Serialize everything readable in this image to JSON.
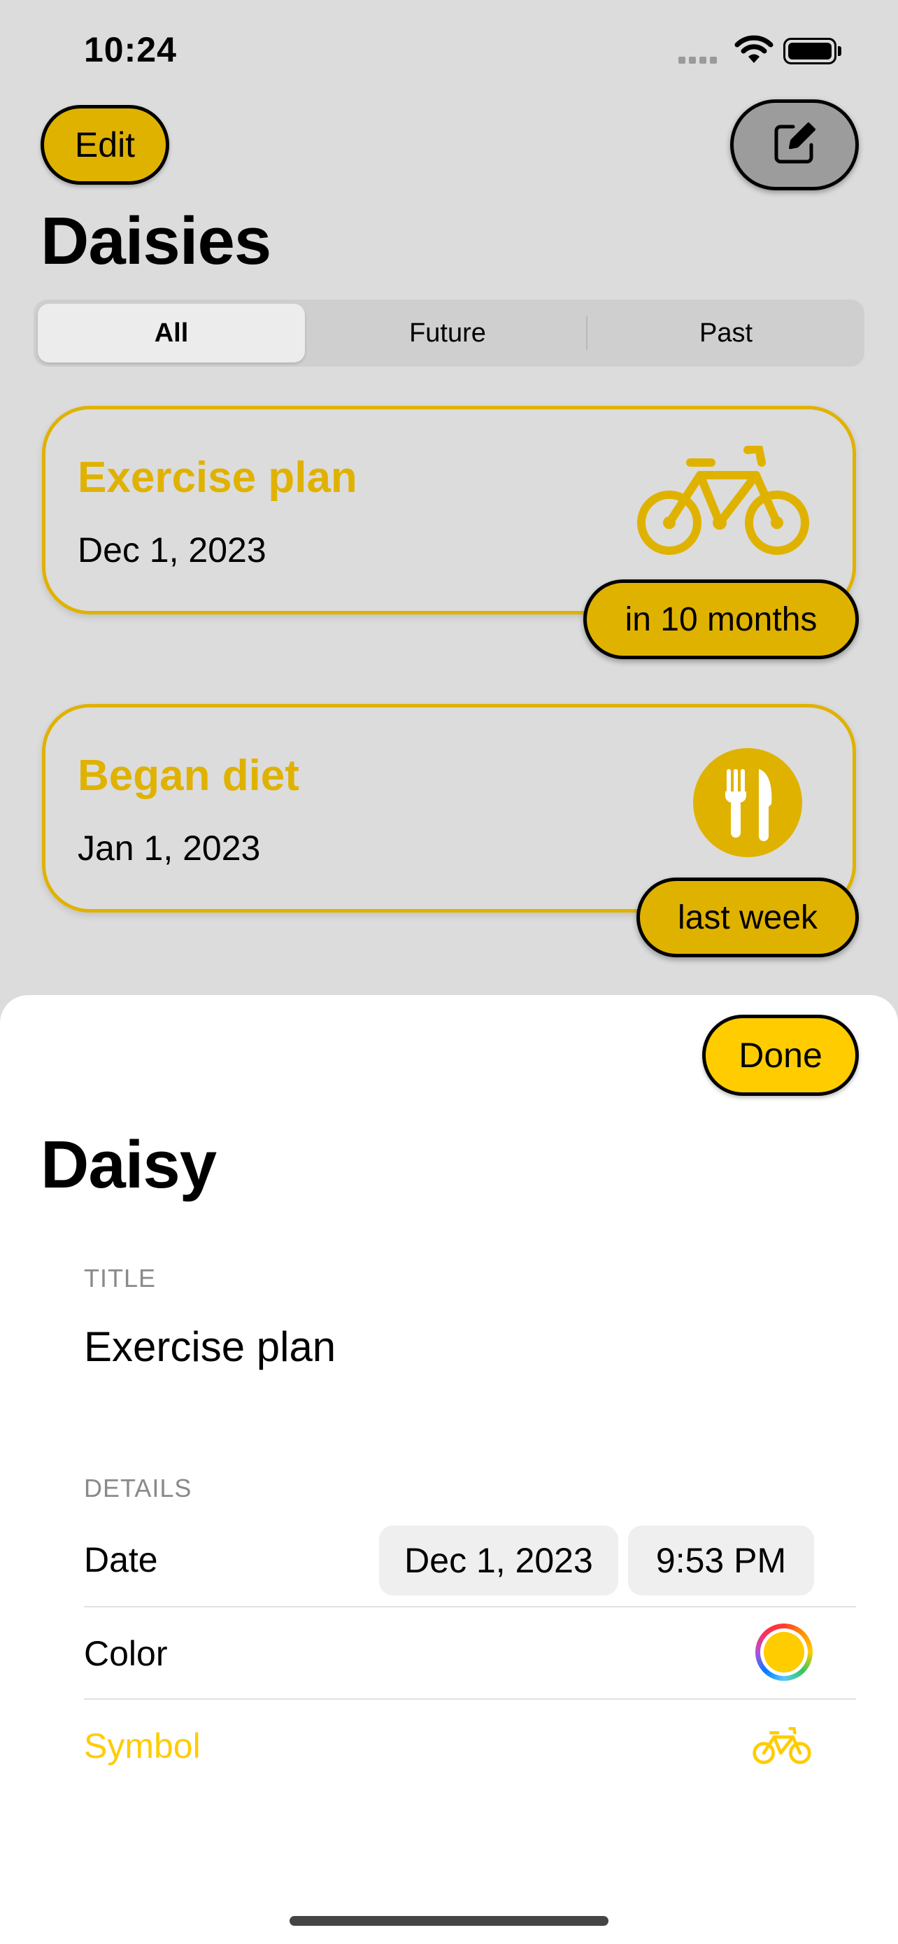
{
  "status_bar": {
    "time": "10:24"
  },
  "toolbar": {
    "edit_label": "Edit",
    "compose_icon": "square-and-pencil-icon"
  },
  "page": {
    "title": "Daisies"
  },
  "segments": [
    "All",
    "Future",
    "Past"
  ],
  "selected_segment": "All",
  "events": [
    {
      "title": "Exercise plan",
      "date": "Dec 1, 2023",
      "relative": "in 10 months",
      "icon": "bicycle-icon"
    },
    {
      "title": "Began diet",
      "date": "Jan 1, 2023",
      "relative": "last week",
      "icon": "fork-knife-icon"
    }
  ],
  "sheet": {
    "done_label": "Done",
    "title": "Daisy",
    "title_section_label": "TITLE",
    "title_value": "Exercise plan",
    "details_section_label": "DETAILS",
    "date_label": "Date",
    "date_value": "Dec 1, 2023",
    "time_value": "9:53 PM",
    "color_label": "Color",
    "color_value": "#ffcc00",
    "symbol_label": "Symbol",
    "symbol_icon": "bicycle-icon"
  },
  "colors": {
    "accent": "#e0b200",
    "sheet_accent": "#ffcc00",
    "background": "#dcdcdc"
  }
}
